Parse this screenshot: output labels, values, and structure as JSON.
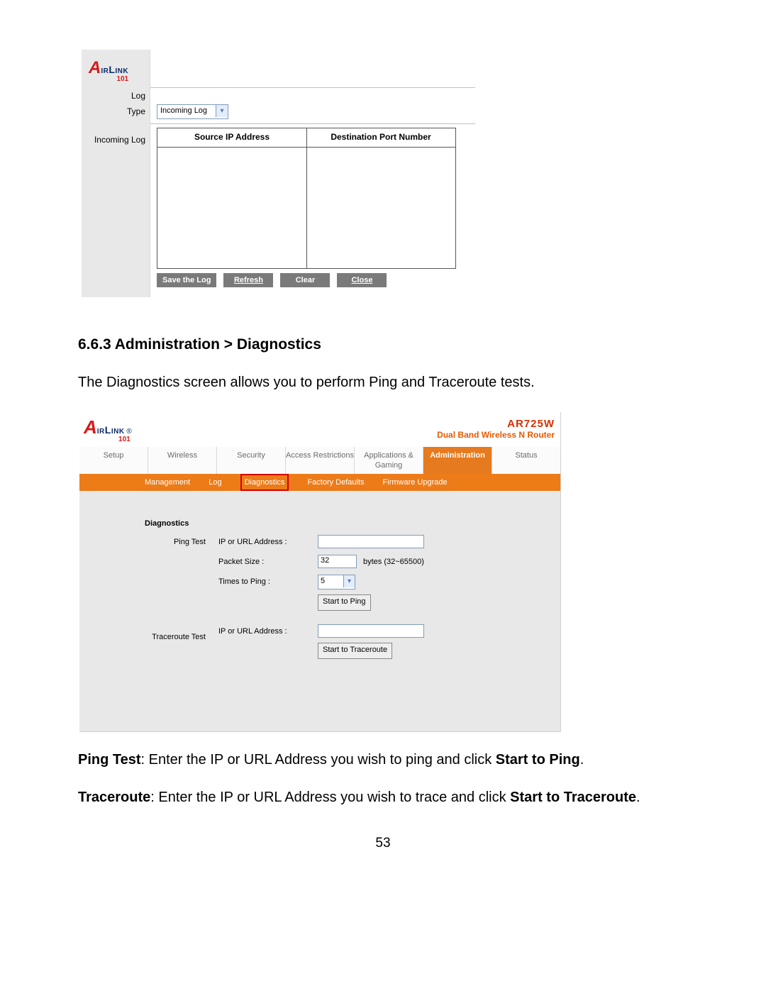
{
  "brand_name": "AirLink 101",
  "model": "AR725W",
  "model_sub": "Dual Band Wireless N Router",
  "log_panel": {
    "label_log": "Log",
    "label_type": "Type",
    "label_incoming": "Incoming Log",
    "type_selected": "Incoming Log",
    "col1": "Source IP Address",
    "col2": "Destination Port Number",
    "buttons": [
      "Save the Log",
      "Refresh",
      "Clear",
      "Close"
    ]
  },
  "section_heading": "6.6.3 Administration > Diagnostics",
  "section_intro": "The Diagnostics screen allows you to perform Ping and Traceroute tests.",
  "diag_panel": {
    "tabs": [
      "Setup",
      "Wireless",
      "Security",
      "Access Restrictions",
      "Applications & Gaming",
      "Administration",
      "Status"
    ],
    "active_tab": "Administration",
    "subtabs": [
      "Management",
      "Log",
      "Diagnostics",
      "Factory Defaults",
      "Firmware Upgrade"
    ],
    "highlight_sub": "Diagnostics",
    "title_diag": "Diagnostics",
    "ping": {
      "row_label": "Ping Test",
      "ip_label": "IP or URL Address :",
      "packet_label": "Packet Size :",
      "packet_value": "32",
      "packet_hint": "bytes (32~65500)",
      "times_label": "Times to Ping :",
      "times_value": "5",
      "button": "Start to Ping"
    },
    "trace": {
      "row_label": "Traceroute Test",
      "ip_label": "IP or URL Address :",
      "button": "Start to Traceroute"
    }
  },
  "desc1_a": "Ping Test",
  "desc1_b": ": Enter the IP or URL Address you wish to ping and click ",
  "desc1_c": "Start to Ping",
  "desc1_d": ".",
  "desc2_a": "Traceroute",
  "desc2_b": ": Enter the IP or URL Address you wish to trace and click ",
  "desc2_c": "Start to Traceroute",
  "desc2_d": ".",
  "page_num": "53"
}
